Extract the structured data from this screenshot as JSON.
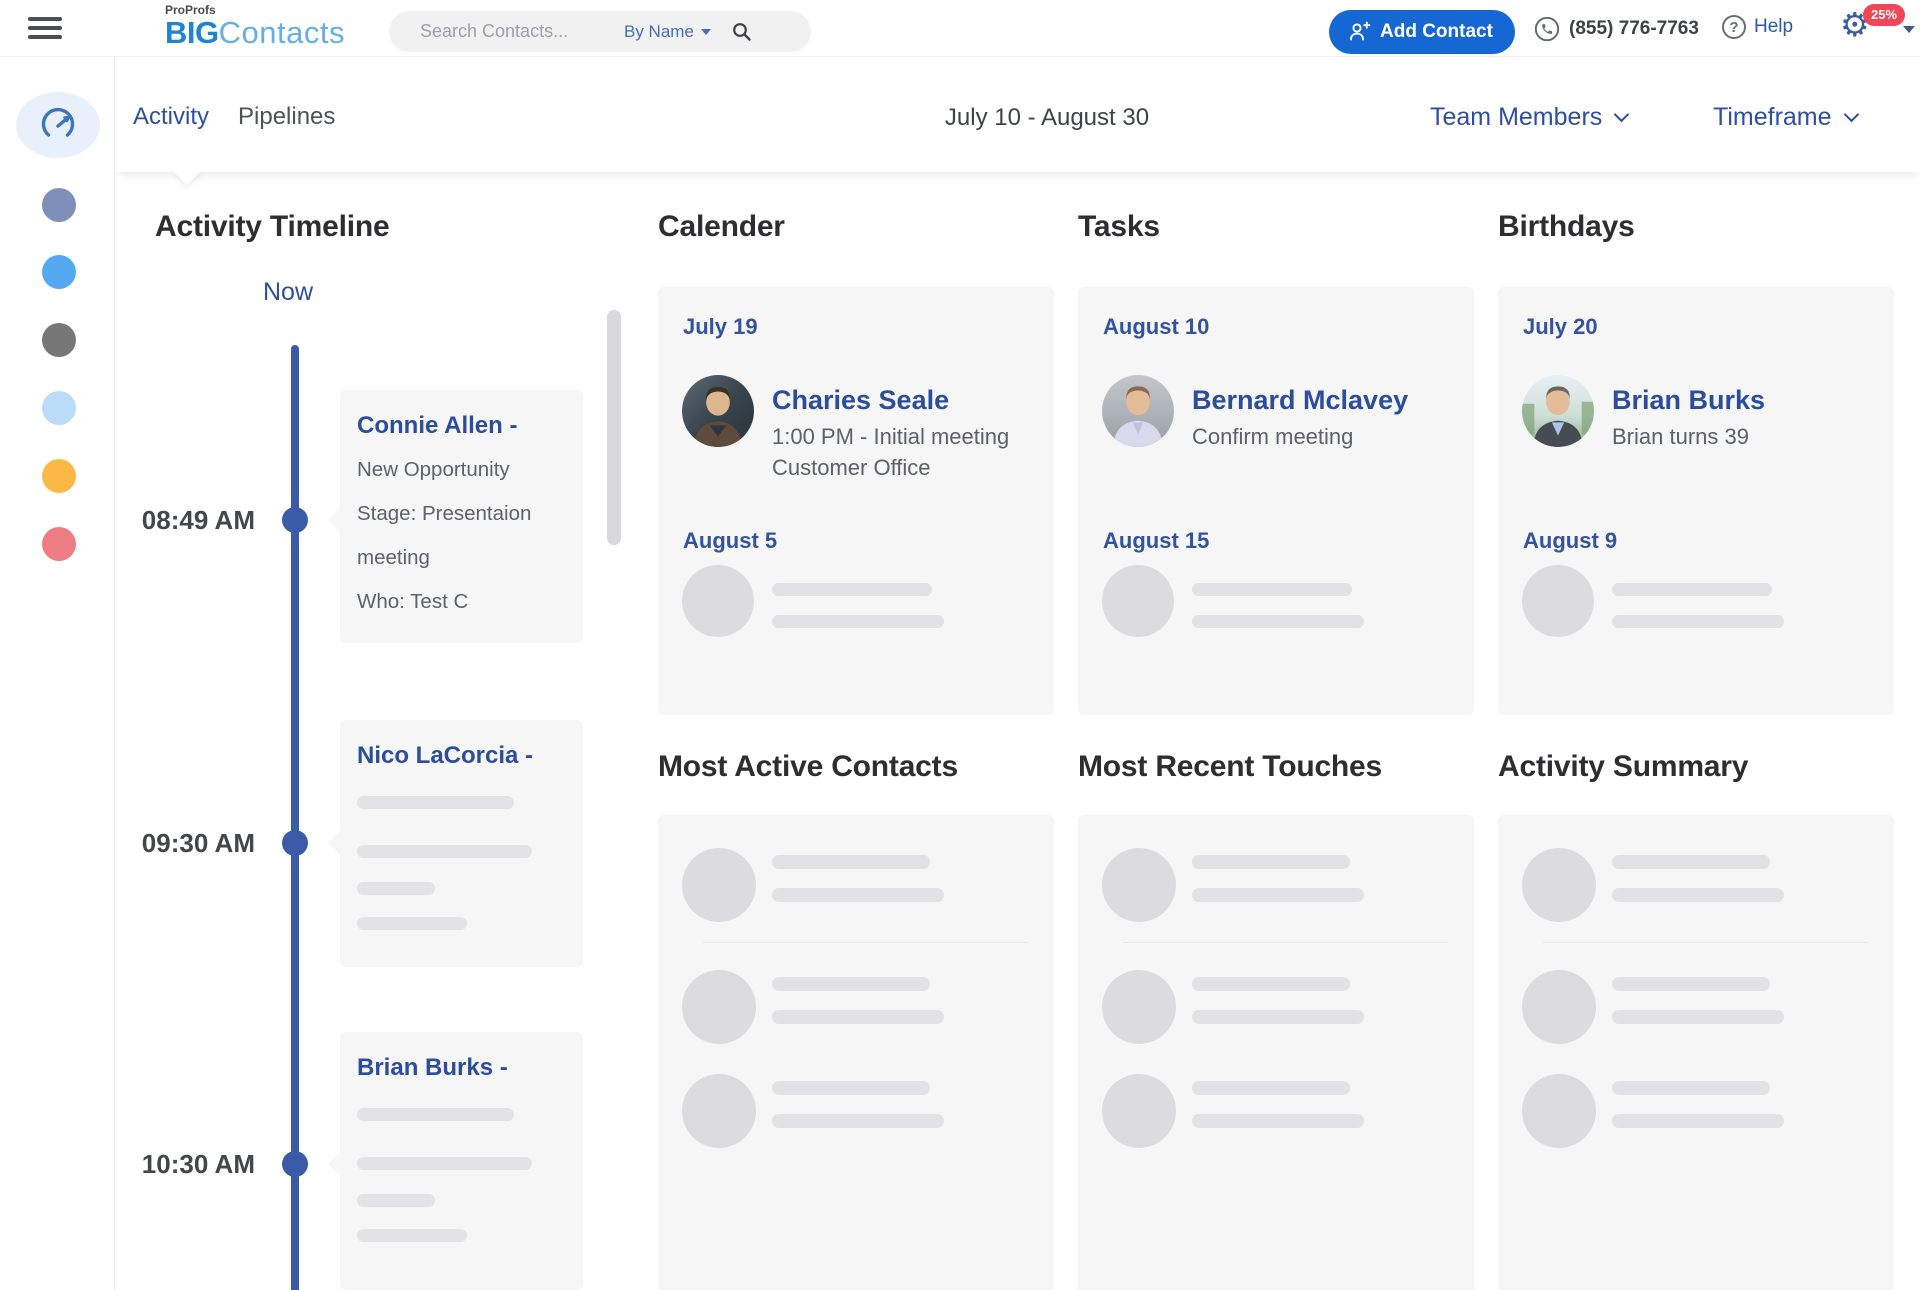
{
  "topbar": {
    "brand": {
      "company": "ProProfs",
      "bold": "BIG",
      "light": "Contacts"
    },
    "search": {
      "placeholder": "Search Contacts...",
      "filter": "By Name"
    },
    "add_contact": "Add Contact",
    "phone": "(855) 776-7763",
    "help": "Help",
    "settings_badge": "25%"
  },
  "icons": {
    "gear": "⚙",
    "help": "?"
  },
  "nav": {
    "tab_activity": "Activity",
    "tab_pipelines": "Pipelines",
    "date_range": "July 10 - August 30",
    "team_members": "Team Members",
    "timeframe": "Timeframe"
  },
  "timeline": {
    "title": "Activity Timeline",
    "now": "Now",
    "entries": [
      {
        "time": "08:49 AM",
        "name": "Connie Allen -",
        "line1": "New Opportunity",
        "line2": "Stage: Presentaion meeting",
        "line3": "Who: Test C"
      },
      {
        "time": "09:30 AM",
        "name": "Nico LaCorcia -"
      },
      {
        "time": "10:30 AM",
        "name": "Brian Burks -"
      }
    ]
  },
  "sections": {
    "calendar": {
      "title": "Calender",
      "date1": "July 19",
      "name": "Charies Seale",
      "detail": "1:00 PM - Initial meeting Customer Office",
      "date2": "August 5"
    },
    "tasks": {
      "title": "Tasks",
      "date1": "August 10",
      "name": "Bernard Mclavey",
      "detail": "Confirm meeting",
      "date2": "August 15"
    },
    "birthdays": {
      "title": "Birthdays",
      "date1": "July 20",
      "name": "Brian Burks",
      "detail": "Brian turns 39",
      "date2": "August 9"
    }
  },
  "bottom": {
    "most_active": "Most Active Contacts",
    "recent_touches": "Most Recent Touches",
    "activity_summary": "Activity Summary"
  },
  "colors": {
    "accent_link_blue": "#2c4d9c",
    "button_blue": "#1568d3",
    "brand_blue": "#1e83d3",
    "badge_red": "#ee4757",
    "timeline_blue": "#3a5ca8",
    "card_gray": "#f6f6f7"
  }
}
